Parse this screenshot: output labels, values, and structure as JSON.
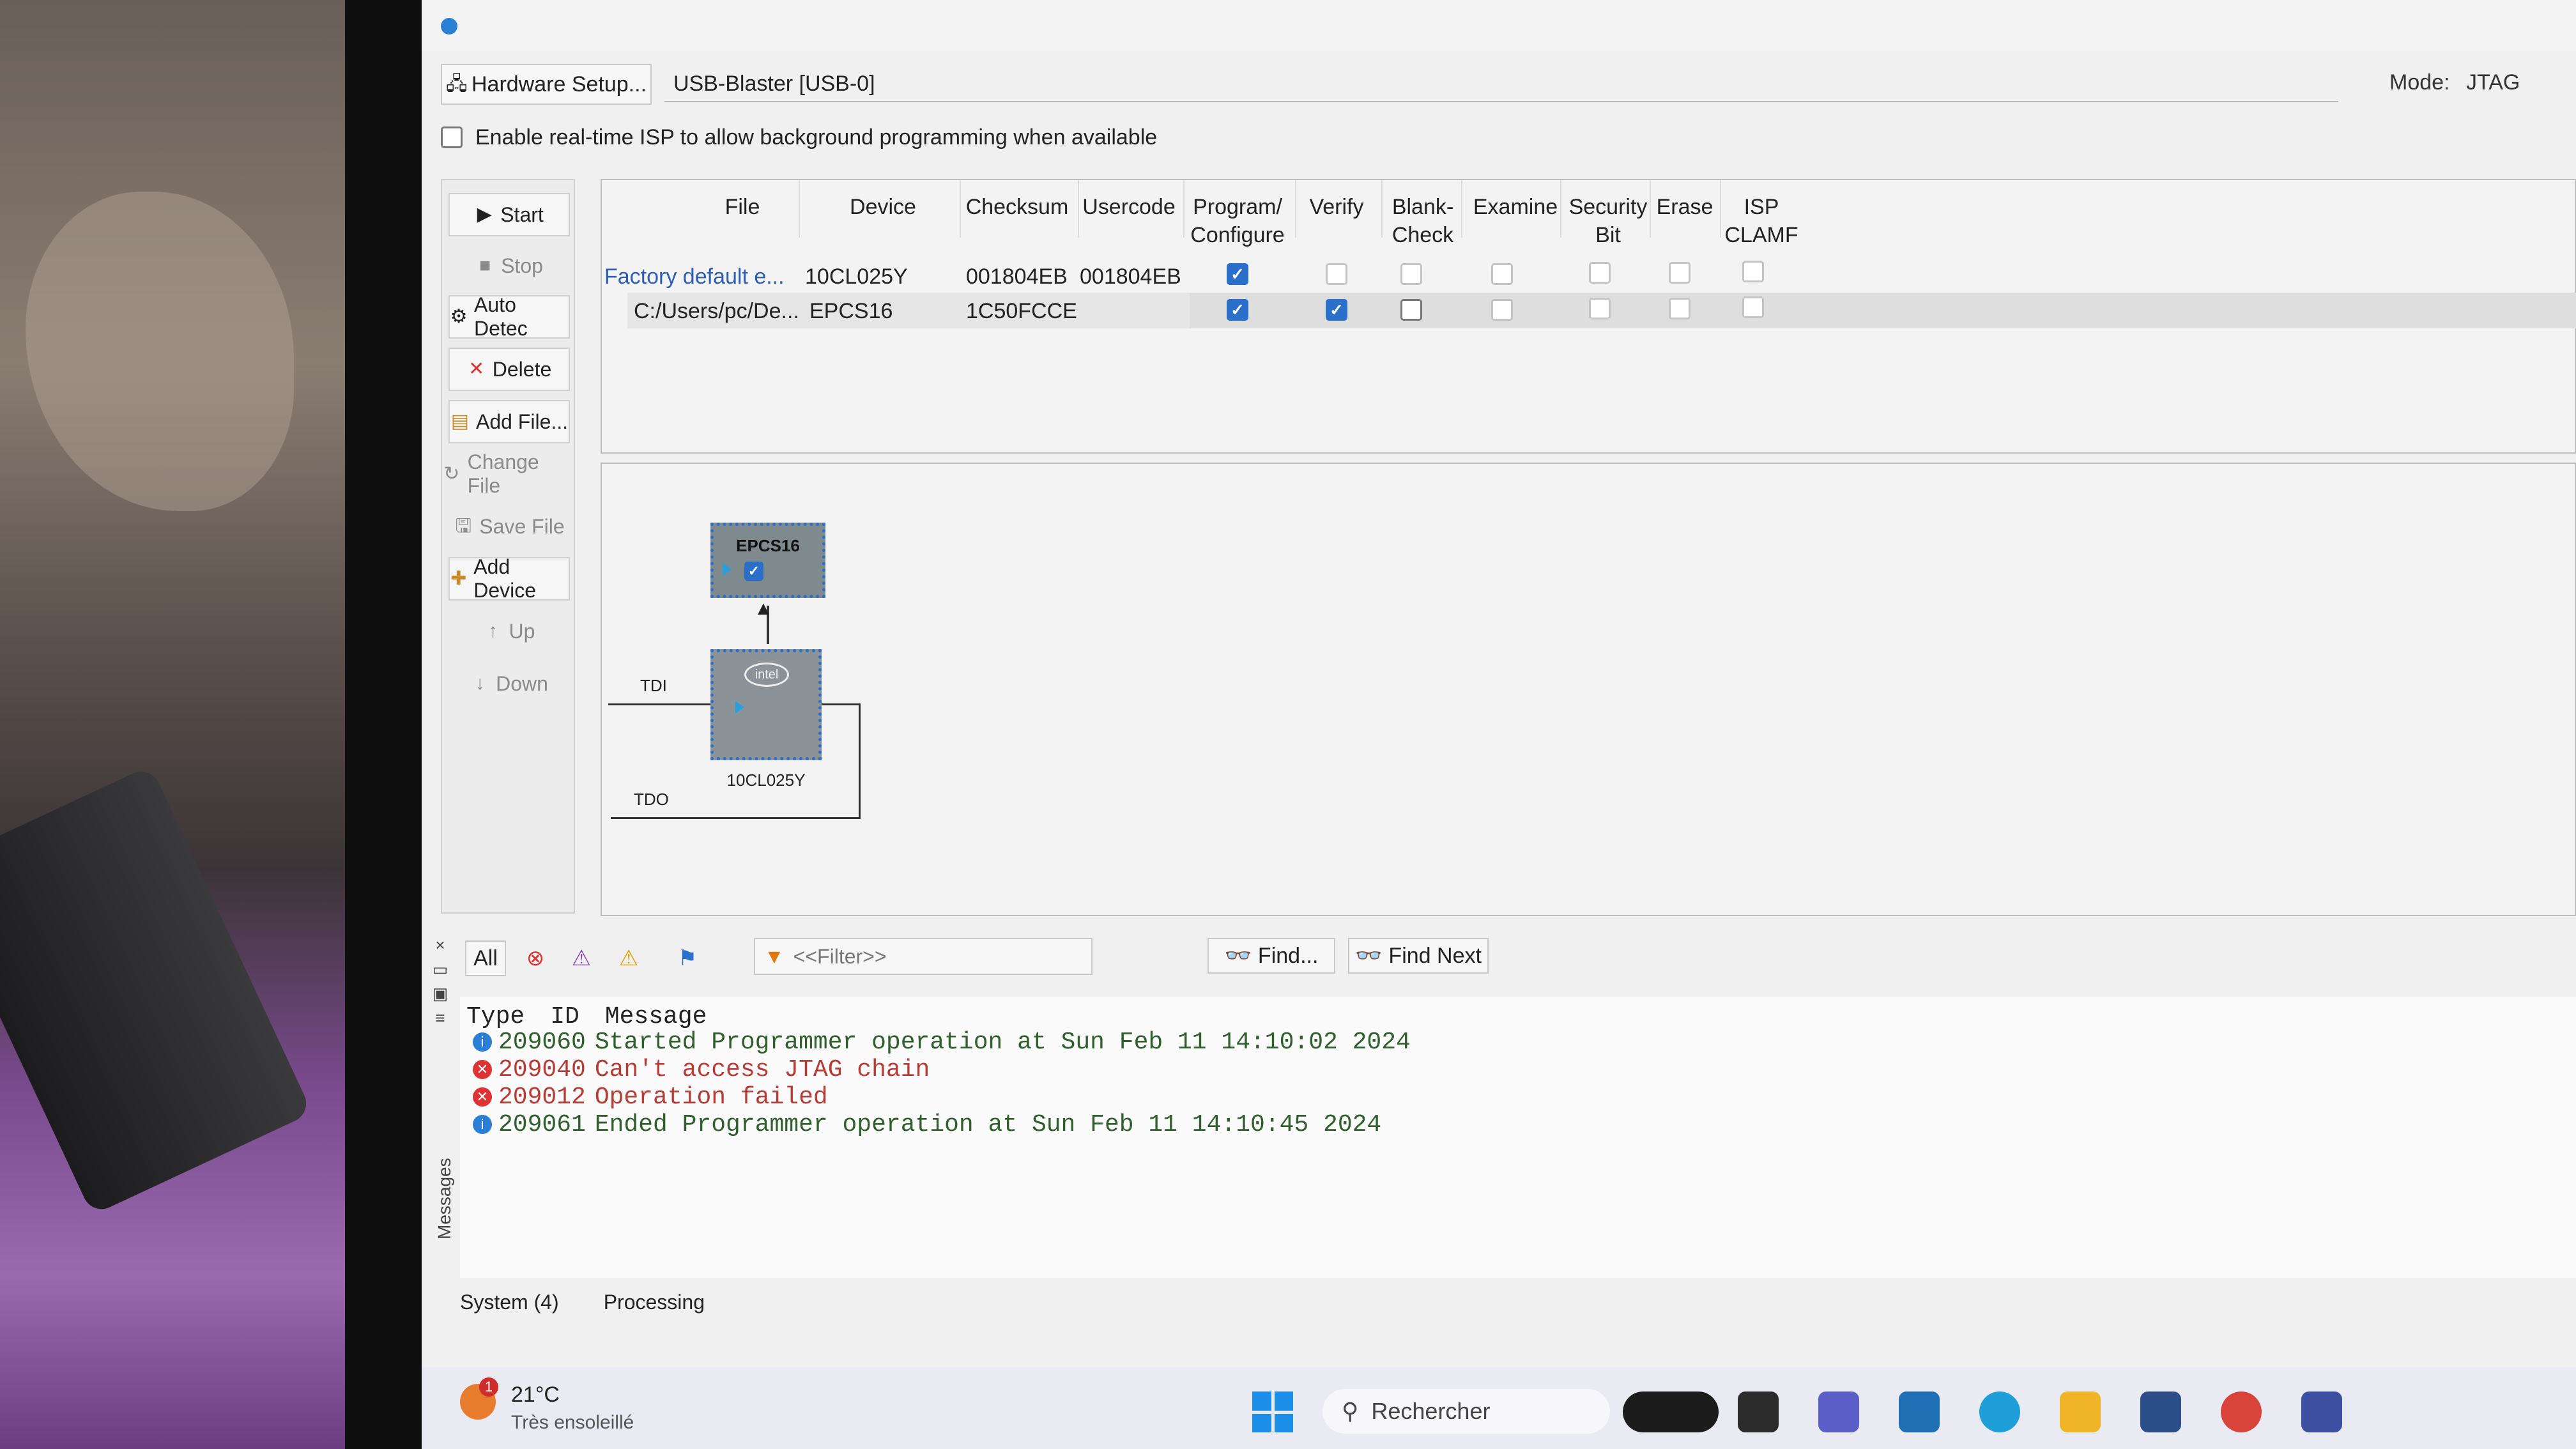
{
  "toolbar": {
    "hardware_setup_label": "Hardware Setup...",
    "hardware_value": "USB-Blaster [USB-0]",
    "mode_label": "Mode:",
    "mode_value": "JTAG"
  },
  "isp": {
    "label": "Enable real-time ISP to allow background programming when available",
    "checked": false
  },
  "side_buttons": [
    {
      "label": "Start",
      "enabled": true
    },
    {
      "label": "Stop",
      "enabled": false
    },
    {
      "label": "Auto Detec",
      "enabled": true
    },
    {
      "label": "Delete",
      "enabled": true
    },
    {
      "label": "Add File...",
      "enabled": true
    },
    {
      "label": "Change File",
      "enabled": false
    },
    {
      "label": "Save File",
      "enabled": false
    },
    {
      "label": "Add Device",
      "enabled": true
    },
    {
      "label": "Up",
      "enabled": false
    },
    {
      "label": "Down",
      "enabled": false
    }
  ],
  "table": {
    "headers": {
      "file": "File",
      "device": "Device",
      "checksum": "Checksum",
      "usercode": "Usercode",
      "program_1": "Program/",
      "program_2": "Configure",
      "verify": "Verify",
      "blank_1": "Blank-",
      "blank_2": "Check",
      "examine": "Examine",
      "security_1": "Security",
      "security_2": "Bit",
      "erase": "Erase",
      "isp_1": "ISP",
      "isp_2": "CLAMF"
    },
    "rows": [
      {
        "file": "Factory default e...",
        "device": "10CL025Y",
        "checksum": "001804EB",
        "usercode": "001804EB",
        "program": true,
        "verify": false,
        "blank_check": false
      },
      {
        "file": "C:/Users/pc/De...",
        "device": "EPCS16",
        "checksum": "1C50FCCE",
        "usercode": "",
        "program": true,
        "verify": true,
        "blank_check": false
      }
    ]
  },
  "chain": {
    "config_device": "EPCS16",
    "fpga_device": "10CL025Y",
    "logo": "intel",
    "tdi": "TDI",
    "tdo": "TDO"
  },
  "messages": {
    "all_label": "All",
    "filter_placeholder": "<<Filter>>",
    "find_label": "Find...",
    "find_next_label": "Find Next",
    "header_type": "Type",
    "header_id": "ID",
    "header_message": "Message",
    "lines": [
      {
        "kind": "info",
        "id": "209060",
        "text": "Started Programmer operation at Sun Feb 11 14:10:02 2024"
      },
      {
        "kind": "error",
        "id": "209040",
        "text": "Can't access JTAG chain"
      },
      {
        "kind": "error",
        "id": "209012",
        "text": "Operation failed"
      },
      {
        "kind": "info",
        "id": "209061",
        "text": "Ended Programmer operation at Sun Feb 11 14:10:45 2024"
      }
    ],
    "tab_system": "System (4)",
    "tab_processing": "Processing",
    "side_title": "Messages"
  },
  "taskbar": {
    "temperature": "21°C",
    "condition": "Très ensoleillé",
    "weather_badge": "1",
    "search_placeholder": "Rechercher"
  },
  "colors": {
    "accent": "#2a6fc9",
    "info_text": "#2f5f2c",
    "error_text": "#b83c36",
    "link": "#2e5eb3"
  }
}
